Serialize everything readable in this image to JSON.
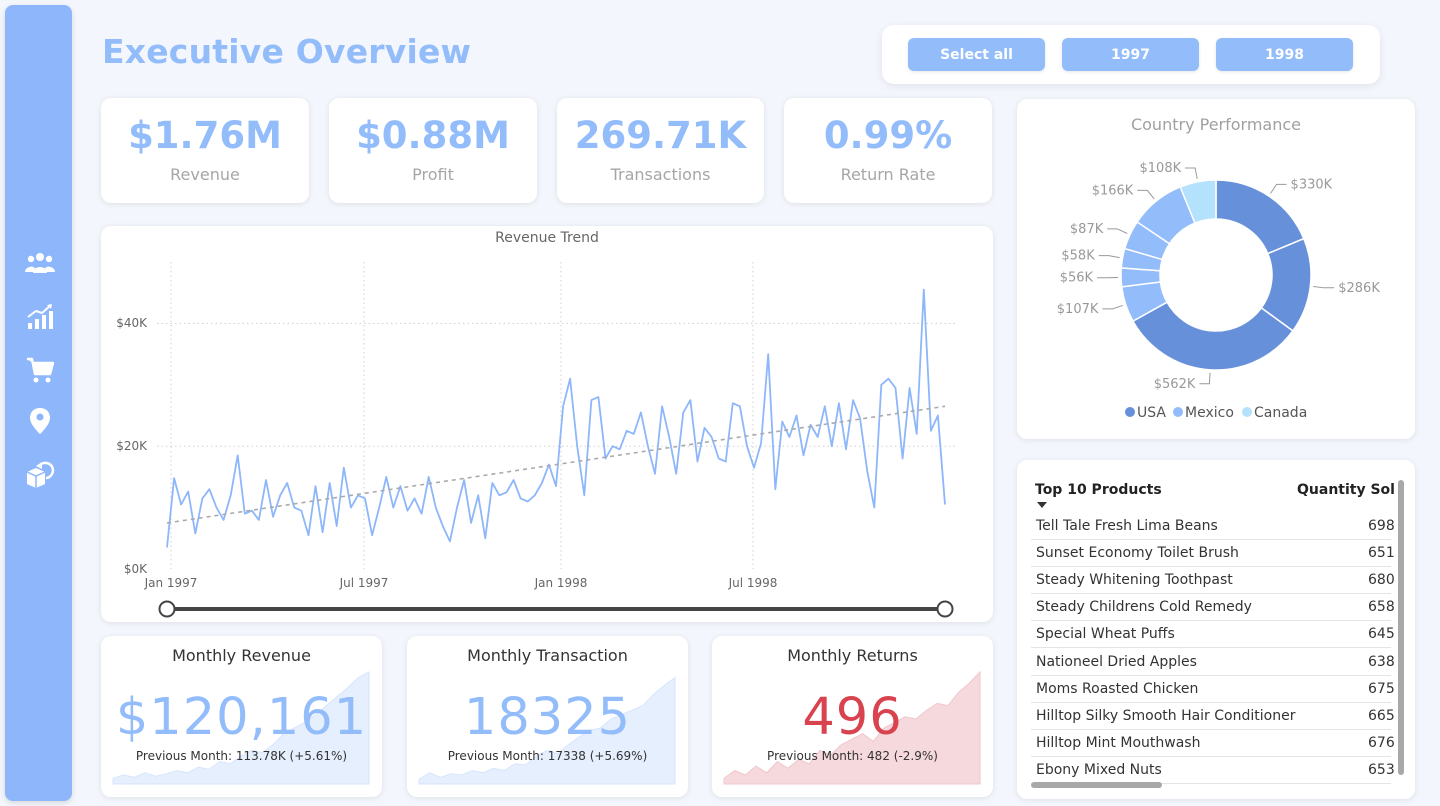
{
  "dashboard": {
    "title": "Executive Overview"
  },
  "filters": {
    "select_all": "Select all",
    "year1": "1997",
    "year2": "1998"
  },
  "sidebar": {
    "icons": [
      "users-icon",
      "chart-trend-icon",
      "cart-icon",
      "location-pin-icon",
      "returns-box-icon"
    ]
  },
  "kpis": [
    {
      "value": "$1.76M",
      "label": "Revenue"
    },
    {
      "value": "$0.88M",
      "label": "Profit"
    },
    {
      "value": "269.71K",
      "label": "Transactions"
    },
    {
      "value": "0.99%",
      "label": "Return Rate"
    }
  ],
  "trend": {
    "title": "Revenue Trend",
    "y_ticks": [
      "$40K",
      "$20K",
      "$0K"
    ],
    "x_ticks": [
      "Jan 1997",
      "Jul 1997",
      "Jan 1998",
      "Jul 1998"
    ]
  },
  "monthly": {
    "revenue": {
      "title": "Monthly Revenue",
      "value": "$120,161",
      "prev": "Previous Month: 113.78K (+5.61%)"
    },
    "transactions": {
      "title": "Monthly Transaction",
      "value": "18325",
      "prev": "Previous Month: 17338 (+5.69%)"
    },
    "returns": {
      "title": "Monthly Returns",
      "value": "496",
      "prev": "Previous Month: 482 (-2.9%)"
    }
  },
  "country": {
    "title": "Country Performance",
    "legend": [
      "USA",
      "Mexico",
      "Canada"
    ],
    "slice_labels": [
      "$330K",
      "$286K",
      "$562K",
      "$107K",
      "$56K",
      "$58K",
      "$87K",
      "$166K",
      "$108K"
    ]
  },
  "top_products": {
    "header_name": "Top 10 Products",
    "header_qty": "Quantity Sold",
    "rows": [
      {
        "name": "Tell Tale Fresh Lima Beans",
        "qty": "698"
      },
      {
        "name": "Sunset Economy Toilet Brush",
        "qty": "651"
      },
      {
        "name": "Steady Whitening Toothpast",
        "qty": "680"
      },
      {
        "name": "Steady Childrens Cold Remedy",
        "qty": "658"
      },
      {
        "name": "Special Wheat Puffs",
        "qty": "645"
      },
      {
        "name": "Nationeel Dried Apples",
        "qty": "638"
      },
      {
        "name": "Moms Roasted Chicken",
        "qty": "675"
      },
      {
        "name": "Hilltop Silky Smooth Hair Conditioner",
        "qty": "665"
      },
      {
        "name": "Hilltop Mint Mouthwash",
        "qty": "676"
      },
      {
        "name": "Ebony Mixed Nuts",
        "qty": "653"
      }
    ]
  },
  "colors": {
    "accent": "#93bcfb",
    "returns_red": "#d9434f",
    "usa": "#6690da",
    "mexico": "#93bcfb",
    "canada": "#b4e1fb"
  },
  "chart_data": [
    {
      "type": "line",
      "title": "Revenue Trend",
      "xlabel": "",
      "ylabel": "",
      "ylim": [
        0,
        50000
      ],
      "x_ticks": [
        "Jan 1997",
        "Jul 1997",
        "Jan 1998",
        "Jul 1998"
      ],
      "series": [
        {
          "values": [
            3500,
            14800,
            10500,
            12600,
            5800,
            11500,
            13000,
            10000,
            8000,
            12000,
            18500,
            9000,
            9500,
            8000,
            14500,
            8500,
            12000,
            14000,
            10000,
            9500,
            5500,
            13500,
            6000,
            14000,
            7000,
            16500,
            10000,
            12000,
            11500,
            5500,
            10000,
            15000,
            10000,
            13500,
            9500,
            11500,
            9000,
            15000,
            10000,
            7000,
            4500,
            10000,
            14500,
            7500,
            12000,
            5000,
            14000,
            12000,
            12500,
            14500,
            11500,
            11000,
            12000,
            14000,
            17000,
            13500,
            26500,
            31000,
            20000,
            12000,
            27500,
            28000,
            18000,
            20000,
            19500,
            22500,
            22000,
            25500,
            20000,
            15500,
            26500,
            21500,
            15500,
            25500,
            27500,
            17500,
            23000,
            21500,
            18000,
            17500,
            27000,
            26500,
            20000,
            16500,
            20500,
            35000,
            13000,
            24000,
            21500,
            25000,
            18500,
            23500,
            21500,
            26500,
            20000,
            27000,
            19500,
            27500,
            24500,
            16000,
            10000,
            30000,
            31000,
            29500,
            18000,
            29500,
            22000,
            45500,
            22500,
            25000,
            10500
          ]
        }
      ],
      "trendline": [
        7500,
        26500
      ]
    },
    {
      "type": "pie",
      "title": "Country Performance",
      "categories": [
        "USA",
        "USA",
        "USA",
        "Mexico",
        "Mexico",
        "Mexico",
        "Mexico",
        "Mexico",
        "Canada"
      ],
      "values": [
        330,
        286,
        562,
        107,
        56,
        58,
        87,
        166,
        108
      ],
      "units": "$K",
      "legend": [
        "USA",
        "Mexico",
        "Canada"
      ]
    },
    {
      "type": "area",
      "title": "Monthly Revenue",
      "values": [
        0.05,
        0.08,
        0.06,
        0.1,
        0.07,
        0.09,
        0.12,
        0.1,
        0.15,
        0.13,
        0.2,
        0.18,
        0.25,
        0.3,
        0.28,
        0.35,
        0.45,
        0.5,
        0.55,
        0.62,
        0.7,
        0.78,
        0.86,
        0.95,
        1.0
      ]
    },
    {
      "type": "area",
      "title": "Monthly Transaction",
      "values": [
        0.04,
        0.1,
        0.06,
        0.09,
        0.08,
        0.12,
        0.1,
        0.14,
        0.12,
        0.18,
        0.17,
        0.25,
        0.3,
        0.27,
        0.35,
        0.42,
        0.48,
        0.5,
        0.58,
        0.62,
        0.66,
        0.7,
        0.8,
        0.88,
        0.95
      ]
    },
    {
      "type": "area",
      "title": "Monthly Returns",
      "values": [
        0.05,
        0.12,
        0.08,
        0.16,
        0.1,
        0.2,
        0.14,
        0.22,
        0.18,
        0.3,
        0.26,
        0.35,
        0.4,
        0.45,
        0.38,
        0.5,
        0.55,
        0.6,
        0.58,
        0.66,
        0.72,
        0.7,
        0.82,
        0.9,
        1.0
      ]
    }
  ]
}
